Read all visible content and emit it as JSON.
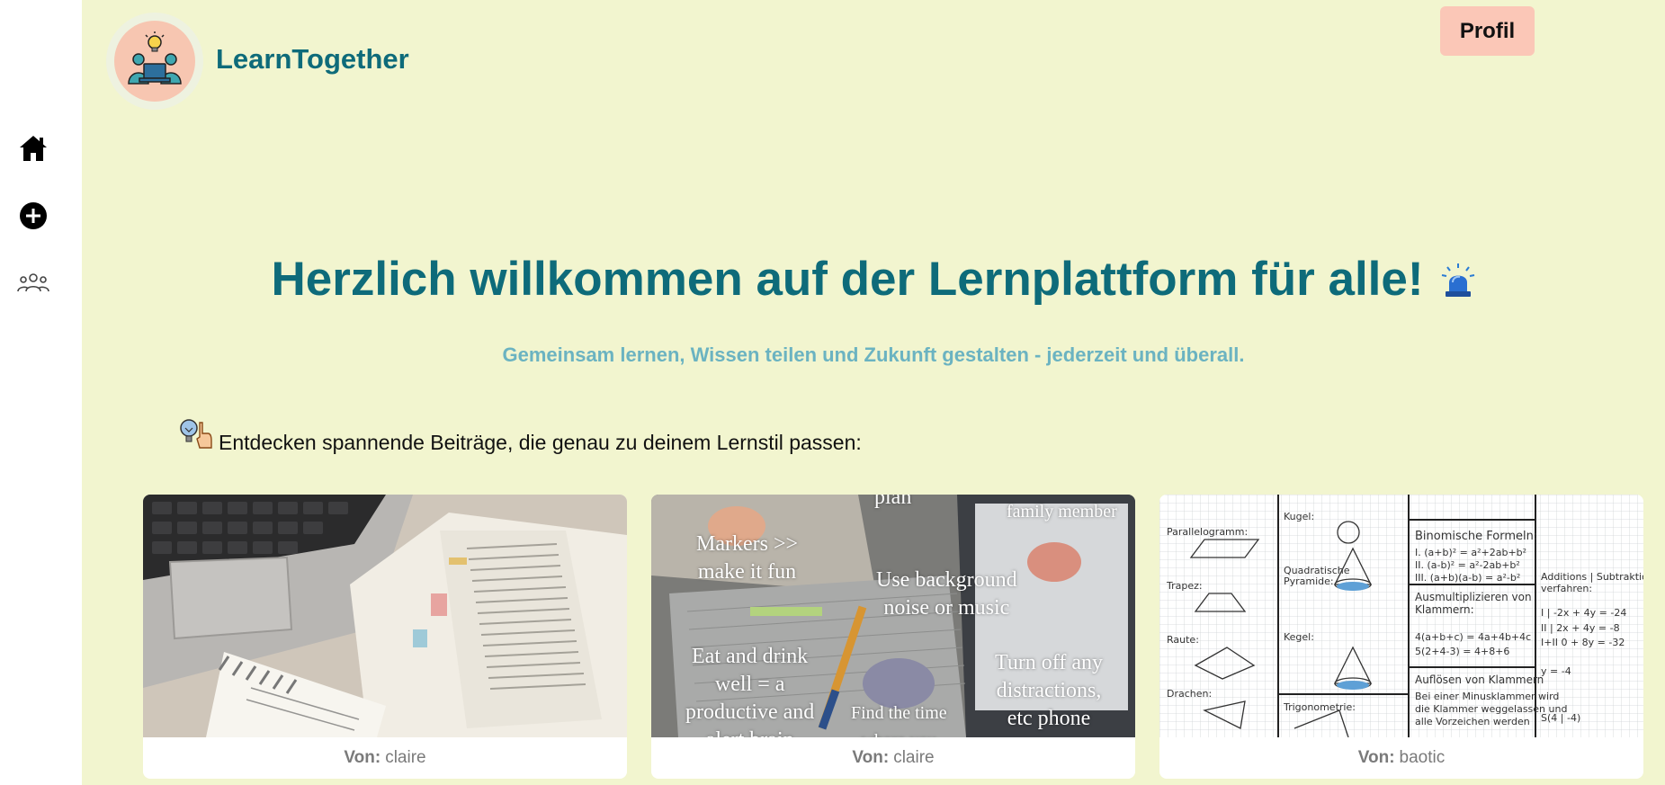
{
  "sidebar": {
    "items": [
      {
        "icon": "home-icon"
      },
      {
        "icon": "plus-circle-icon"
      },
      {
        "icon": "group-icon"
      }
    ]
  },
  "header": {
    "brand": "LearnTogether",
    "profile_label": "Profil"
  },
  "hero": {
    "title": "Herzlich willkommen auf der Lernplattform für alle!",
    "subtitle": "Gemeinsam lernen, Wissen teilen und Zukunft gestalten - jederzeit und überall."
  },
  "discover": {
    "text": "Entdecken spannende Beiträge, die genau zu deinem Lernstil passen:"
  },
  "posts": [
    {
      "by_label": "Von:",
      "author": "claire"
    },
    {
      "by_label": "Von:",
      "author": "claire",
      "overlay": {
        "top_partial": "plan",
        "family": "family member",
        "markers": "Markers >>\nmake it fun",
        "background": "Use background\nnoise or music",
        "eat": "Eat and drink\nwell = a\nproductive and\nalert brain",
        "distractions": "Turn off any\ndistractions,\netc phone",
        "time": "Find the time\nwhere you"
      }
    },
    {
      "by_label": "Von:",
      "author": "baotic"
    }
  ],
  "colors": {
    "page_bg": "#f2f5cf",
    "brand": "#0e6b7a",
    "subtitle": "#6bb3c1",
    "profile_bg": "#fbc7b7",
    "sidebar_bg": "#ffffff"
  }
}
